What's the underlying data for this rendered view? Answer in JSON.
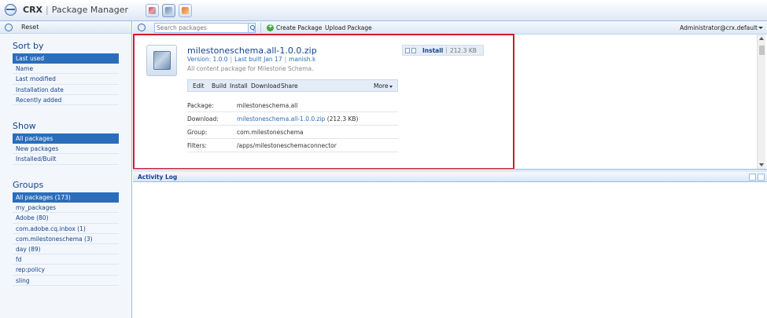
{
  "app": {
    "brand": "CRX",
    "title": "Package Manager"
  },
  "toolbar": {
    "reset_label": "Reset",
    "search_placeholder": "Search packages",
    "create_label": "Create Package",
    "upload_label": "Upload Package",
    "user_label": "Administrator@crx.default"
  },
  "sidebar": {
    "sort_heading": "Sort by",
    "sort_items": [
      {
        "label": "Last used",
        "selected": true
      },
      {
        "label": "Name"
      },
      {
        "label": "Last modified"
      },
      {
        "label": "Installation date"
      },
      {
        "label": "Recently added"
      }
    ],
    "show_heading": "Show",
    "show_items": [
      {
        "label": "All packages",
        "selected": true
      },
      {
        "label": "New packages"
      },
      {
        "label": "Installed/Built"
      }
    ],
    "groups_heading": "Groups",
    "group_items": [
      {
        "label": "All packages (173)",
        "selected": true
      },
      {
        "label": "my_packages"
      },
      {
        "label": "Adobe (80)"
      },
      {
        "label": "com.adobe.cq.inbox (1)"
      },
      {
        "label": "com.milestoneschema (3)"
      },
      {
        "label": "day (89)"
      },
      {
        "label": "fd"
      },
      {
        "label": "rep:policy"
      },
      {
        "label": "sling"
      }
    ]
  },
  "package": {
    "name": "milestoneschema.all-1.0.0.zip",
    "version": "Version: 1.0.0",
    "last_built": "Last built Jan 17",
    "author": "manish.k",
    "description": "All content package for Milestone Schema.",
    "actions": [
      "Edit",
      "Build",
      "Install",
      "Download",
      "Share"
    ],
    "more_label": "More",
    "install_label": "Install",
    "install_size": "212.3 KB",
    "properties": [
      {
        "key": "Package:",
        "value": "milestoneschema.all"
      },
      {
        "key": "Download:",
        "value": "milestoneschema.all-1.0.0.zip",
        "suffix": "(212.3 KB)"
      },
      {
        "key": "Group:",
        "value": "com.milestoneschema"
      },
      {
        "key": "Filters:",
        "value": "/apps/milestoneschemaconnector"
      }
    ]
  },
  "activity_log": {
    "title": "Activity Log"
  },
  "colors": {
    "highlight": "#d11a2a",
    "selected": "#2a6ebb",
    "link": "#2a6ebb"
  }
}
